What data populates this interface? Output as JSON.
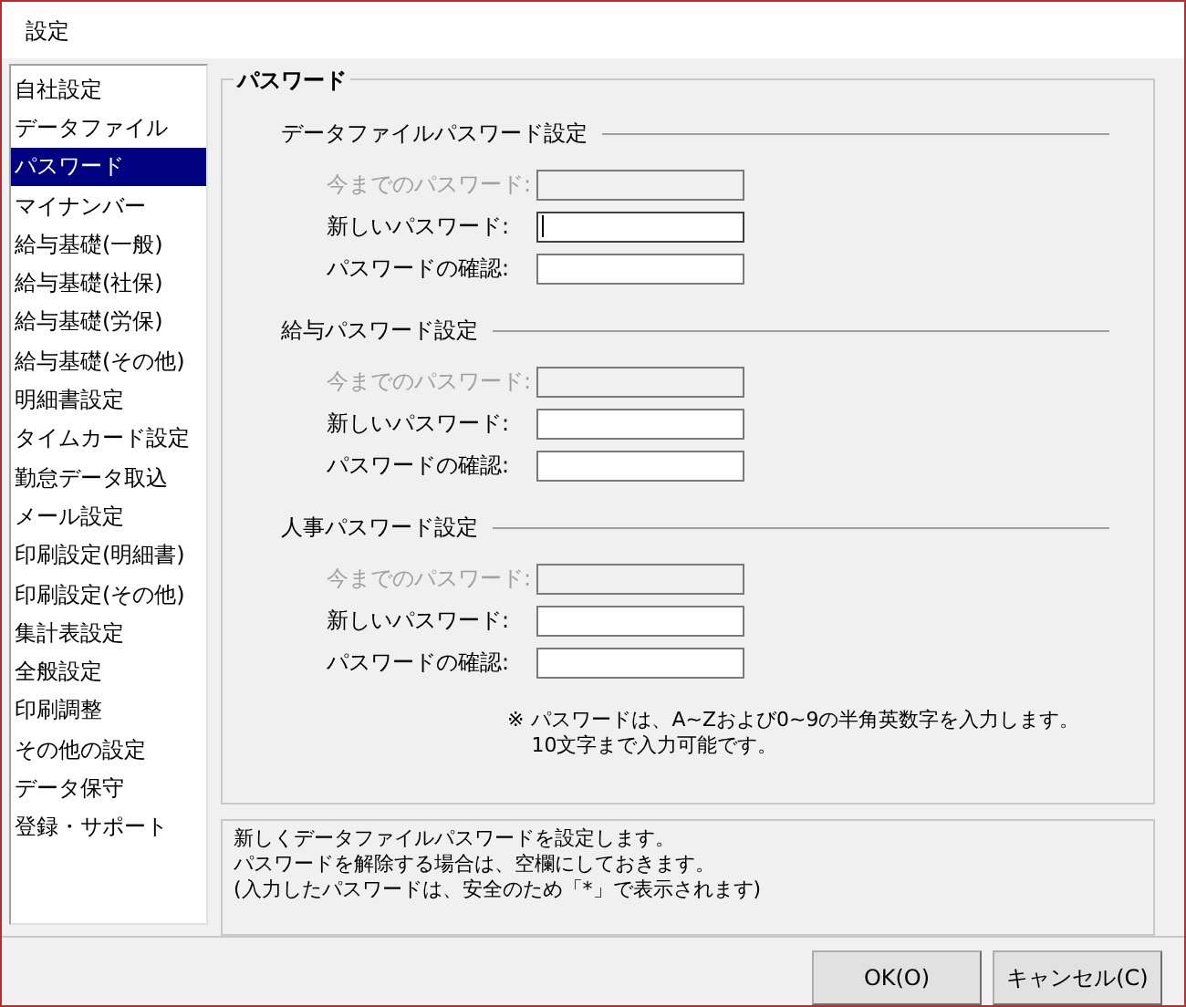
{
  "window": {
    "title": "設定"
  },
  "sidebar": {
    "items": [
      {
        "label": "自社設定",
        "selected": false
      },
      {
        "label": "データファイル",
        "selected": false
      },
      {
        "label": "パスワード",
        "selected": true
      },
      {
        "label": "マイナンバー",
        "selected": false
      },
      {
        "label": "給与基礎(一般)",
        "selected": false
      },
      {
        "label": "給与基礎(社保)",
        "selected": false
      },
      {
        "label": "給与基礎(労保)",
        "selected": false
      },
      {
        "label": "給与基礎(その他)",
        "selected": false
      },
      {
        "label": "明細書設定",
        "selected": false
      },
      {
        "label": "タイムカード設定",
        "selected": false
      },
      {
        "label": "勤怠データ取込",
        "selected": false
      },
      {
        "label": "メール設定",
        "selected": false
      },
      {
        "label": "印刷設定(明細書)",
        "selected": false
      },
      {
        "label": "印刷設定(その他)",
        "selected": false
      },
      {
        "label": "集計表設定",
        "selected": false
      },
      {
        "label": "全般設定",
        "selected": false
      },
      {
        "label": "印刷調整",
        "selected": false
      },
      {
        "label": "その他の設定",
        "selected": false
      },
      {
        "label": "データ保守",
        "selected": false
      },
      {
        "label": "登録・サポート",
        "selected": false
      }
    ]
  },
  "panel": {
    "title": "パスワード",
    "sections": [
      {
        "title": "データファイルパスワード設定",
        "fields": [
          {
            "label": "今までのパスワード:",
            "disabled": true,
            "focused": false
          },
          {
            "label": "新しいパスワード:",
            "disabled": false,
            "focused": true
          },
          {
            "label": "パスワードの確認:",
            "disabled": false,
            "focused": false
          }
        ]
      },
      {
        "title": "給与パスワード設定",
        "fields": [
          {
            "label": "今までのパスワード:",
            "disabled": true,
            "focused": false
          },
          {
            "label": "新しいパスワード:",
            "disabled": false,
            "focused": false
          },
          {
            "label": "パスワードの確認:",
            "disabled": false,
            "focused": false
          }
        ]
      },
      {
        "title": "人事パスワード設定",
        "fields": [
          {
            "label": "今までのパスワード:",
            "disabled": true,
            "focused": false
          },
          {
            "label": "新しいパスワード:",
            "disabled": false,
            "focused": false
          },
          {
            "label": "パスワードの確認:",
            "disabled": false,
            "focused": false
          }
        ]
      }
    ],
    "note_mark": "※",
    "note_lines": [
      "パスワードは、A~Zおよび0~9の半角英数字を入力します。",
      "10文字まで入力可能です。"
    ]
  },
  "info": {
    "lines": [
      "新しくデータファイルパスワードを設定します。",
      "パスワードを解除する場合は、空欄にしておきます。",
      "(入力したパスワードは、安全のため「*」で表示されます)"
    ]
  },
  "buttons": [
    "OK(O)",
    "キャンセル(C)"
  ]
}
